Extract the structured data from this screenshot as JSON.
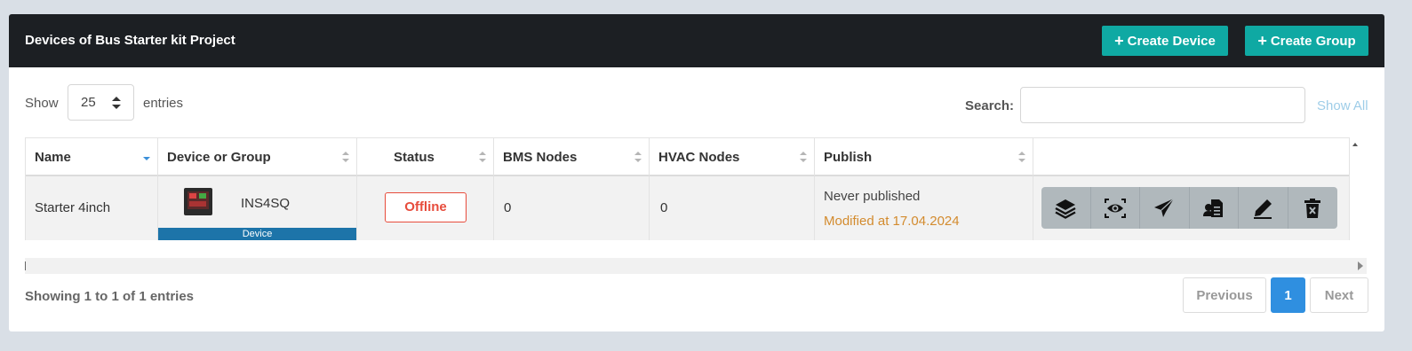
{
  "header": {
    "title": "Devices of Bus Starter kit Project",
    "create_device": "Create Device",
    "create_group": "Create Group",
    "plus": "+"
  },
  "length": {
    "show": "Show",
    "value": "25",
    "entries": "entries"
  },
  "search": {
    "label": "Search:",
    "value": "",
    "show_all": "Show All"
  },
  "columns": [
    "Name",
    "Device or Group",
    "Status",
    "BMS Nodes",
    "HVAC Nodes",
    "Publish"
  ],
  "rows": [
    {
      "name": "Starter 4inch",
      "device_code": "INS4SQ",
      "device_type": "Device",
      "status": "Offline",
      "bms_nodes": "0",
      "hvac_nodes": "0",
      "publish": "Never published",
      "modified": "Modified at 17.04.2024"
    }
  ],
  "actions": [
    "layers-icon",
    "eye-icon",
    "send-icon",
    "document-icon",
    "edit-icon",
    "trash-icon"
  ],
  "footer": {
    "info": "Showing 1 to 1 of 1 entries",
    "previous": "Previous",
    "page": "1",
    "next": "Next"
  },
  "colors": {
    "header_bg": "#1c1f23",
    "accent": "#0fa9a3",
    "status_offline": "#e74c3c",
    "page_active": "#2f8fe0",
    "modified": "#d38b2e"
  }
}
